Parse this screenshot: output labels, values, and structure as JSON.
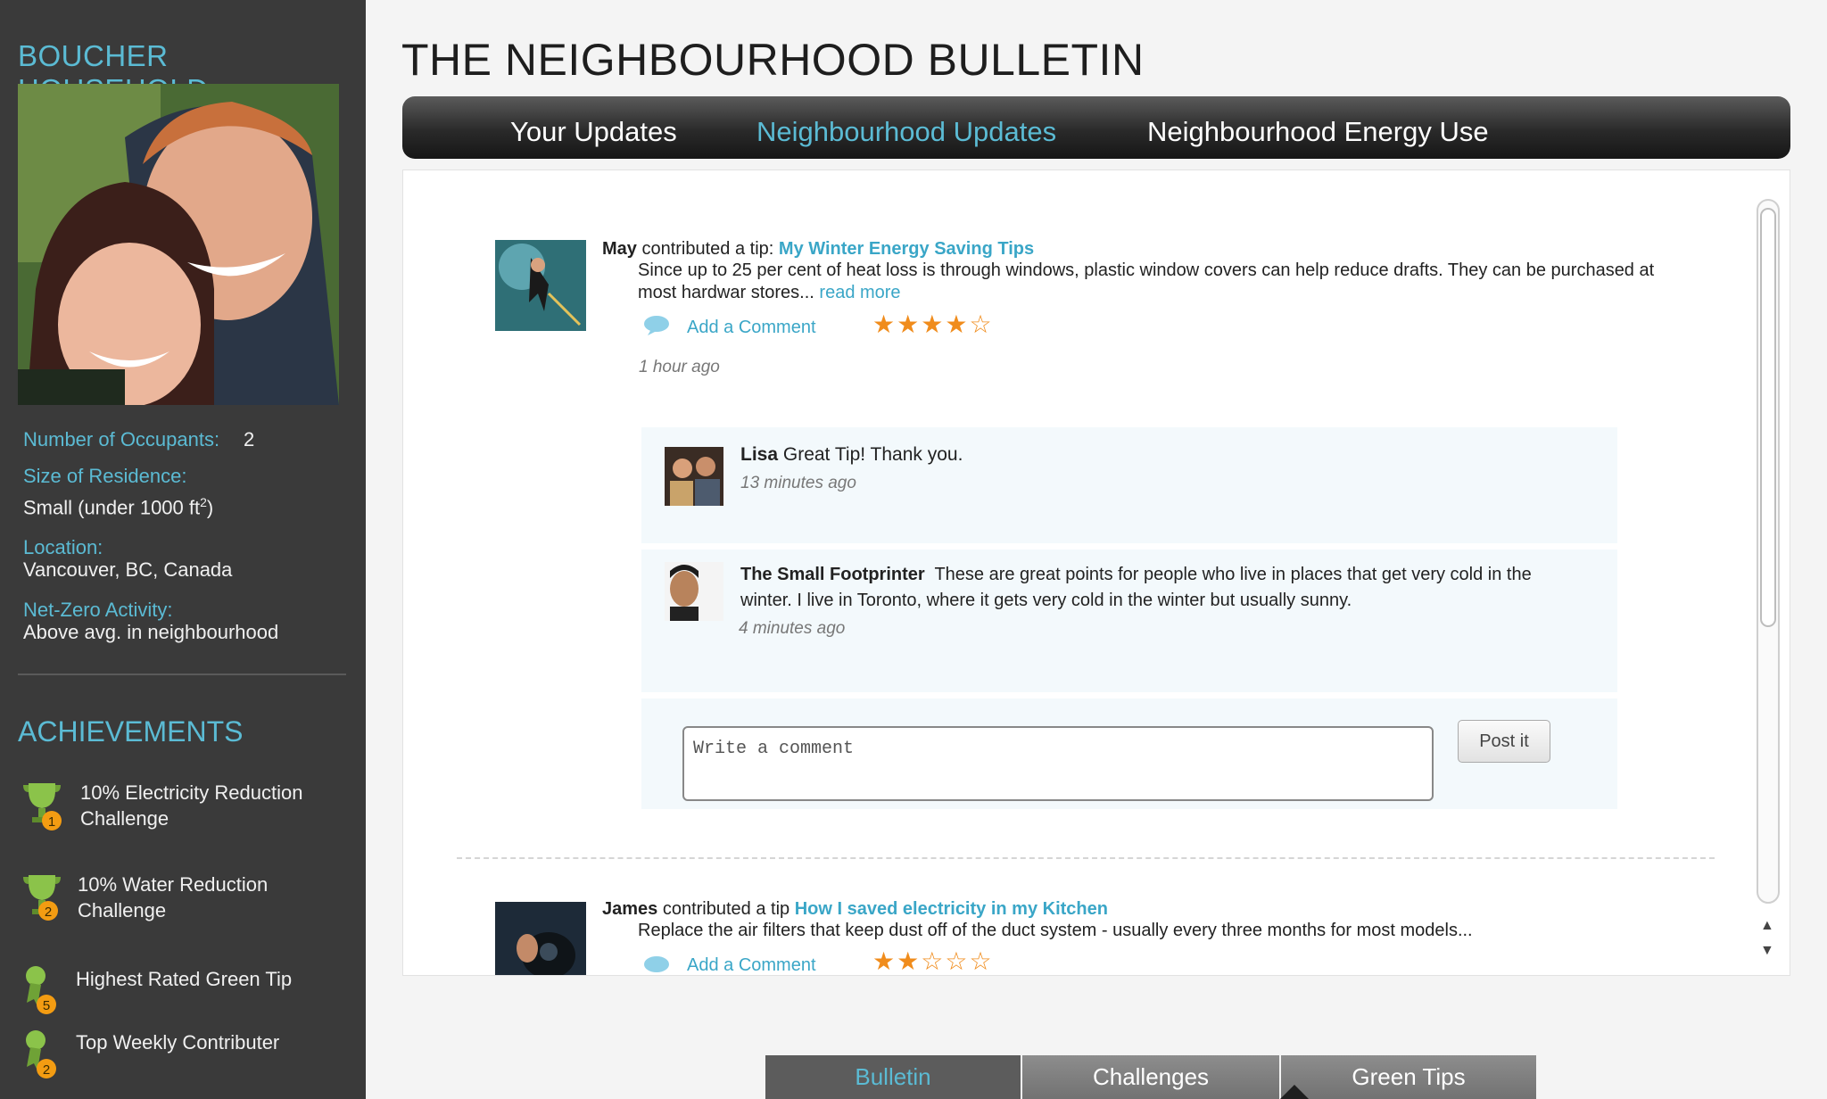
{
  "sidebar": {
    "household": "BOUCHER HOUSEHOLD",
    "occupants_label": "Number of Occupants:",
    "occupants_value": "2",
    "size_label": "Size of Residence:",
    "size_value": "Small (under 1000 ft",
    "size_sup": "2",
    "size_close": ")",
    "location_label": "Location:",
    "location_value": "Vancouver, BC, Canada",
    "netzero_label": "Net-Zero Activity:",
    "netzero_value": "Above avg. in neighbourhood",
    "achievements_title": "ACHIEVEMENTS",
    "achievements": [
      {
        "line1": "10% Electricity Reduction",
        "line2": "Challenge",
        "badge": "1"
      },
      {
        "line1": "10% Water Reduction",
        "line2": "Challenge",
        "badge": "2"
      },
      {
        "line1": "Highest Rated Green Tip",
        "line2": "",
        "badge": "5"
      },
      {
        "line1": "Top Weekly Contributer",
        "line2": "",
        "badge": "2"
      }
    ]
  },
  "header": {
    "title": "THE NEIGHBOURHOOD BULLETIN",
    "tabs": [
      "Your Updates",
      "Neighbourhood Updates",
      "Neighbourhood Energy Use"
    ],
    "active_tab": "Neighbourhood Updates"
  },
  "posts": [
    {
      "author": "May",
      "action": "contributed a tip:",
      "tip_title": "My Winter Energy Saving Tips",
      "body": "Since up to 25 per cent of heat loss is through windows, plastic window covers can help reduce drafts. They can be purchased at most hardwar stores...",
      "read_more": "read more",
      "add_comment": "Add a Comment",
      "rating": 4,
      "rating_max": 5,
      "time": "1 hour ago",
      "comments": [
        {
          "author": "Lisa",
          "text": "Great Tip! Thank you.",
          "time": "13 minutes ago"
        },
        {
          "author": "The Small Footprinter",
          "text": "These are great points for people who live in places that get very cold in the winter. I live in Toronto, where it gets very cold in the winter but usually sunny.",
          "time": "4 minutes ago"
        }
      ],
      "comment_placeholder": "Write a comment",
      "post_button": "Post it"
    },
    {
      "author": "James",
      "action": "contributed a tip",
      "tip_title": "How I saved electricity in my Kitchen",
      "body": "Replace the air filters that keep dust off of the duct system - usually every three months for most models...",
      "add_comment": "Add a Comment",
      "rating": 2,
      "rating_max": 5
    }
  ],
  "bottom_tabs": [
    "Bulletin",
    "Challenges",
    "Green Tips"
  ],
  "colors": {
    "accent": "#5bbbd4",
    "link": "#3aa6c7",
    "star": "#f08c1c",
    "sidebar": "#3a3a3a"
  }
}
